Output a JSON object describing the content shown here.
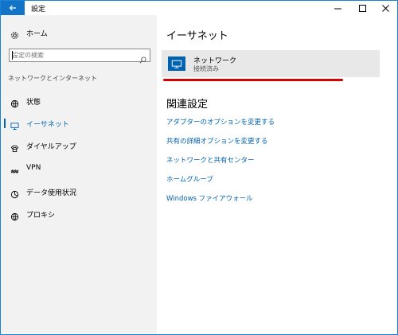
{
  "window": {
    "title": "設定",
    "controls": [
      "minimize-icon",
      "maximize-icon",
      "close-icon"
    ],
    "accent": "#1174c7"
  },
  "sidebar": {
    "home_label": "ホーム",
    "search_placeholder": "設定の検索",
    "section_label": "ネットワークとインターネット",
    "items": [
      {
        "label": "状態",
        "icon": "status-globe-icon",
        "active": false
      },
      {
        "label": "イーサネット",
        "icon": "ethernet-icon",
        "active": true
      },
      {
        "label": "ダイヤルアップ",
        "icon": "dialup-icon",
        "active": false
      },
      {
        "label": "VPN",
        "icon": "vpn-icon",
        "active": false
      },
      {
        "label": "データ使用状況",
        "icon": "data-usage-icon",
        "active": false
      },
      {
        "label": "プロキシ",
        "icon": "proxy-globe-icon",
        "active": false
      }
    ]
  },
  "main": {
    "title": "イーサネット",
    "network": {
      "name": "ネットワーク",
      "status": "接続済み",
      "icon": "monitor-icon"
    },
    "related_title": "関連設定",
    "links": [
      "アダプターのオプションを変更する",
      "共有の詳細オプションを変更する",
      "ネットワークと共有センター",
      "ホームグループ",
      "Windows ファイアウォール"
    ]
  },
  "colors": {
    "link": "#0063b1",
    "sidebar_bg": "#f2f2f2",
    "annotation": "#d50000"
  }
}
